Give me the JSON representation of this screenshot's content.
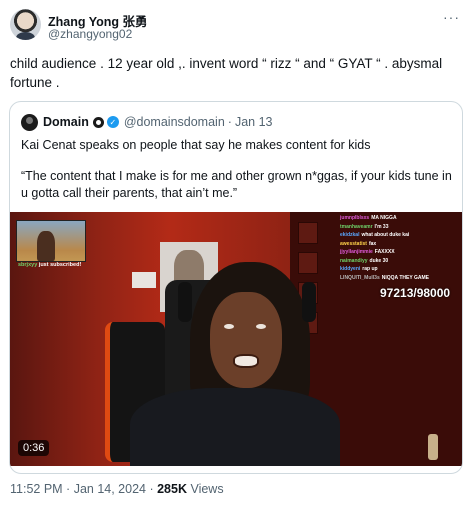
{
  "author": {
    "name": "Zhang Yong 张勇",
    "handle": "@zhangyong02",
    "more_icon": "···"
  },
  "tweet": {
    "text": "child audience . 12 year old  ,. invent word “ rizz “ and “ GYAT “ . abysmal fortune ."
  },
  "quote": {
    "name": "Domain",
    "verified_icon": "✓",
    "handle": "@domainsdomain",
    "dot": "·",
    "date": "Jan 13",
    "line1": "Kai Cenat speaks on people that say he makes content for kids",
    "quote_text": "“The content that I make is for me and other grown n*ggas, if your kids tune in u gotta call their parents, that ain’t me.”"
  },
  "video": {
    "duration": "0:36",
    "counter": "97213/98000",
    "pip_user": "sbrjxyy",
    "pip_msg": " just subscribed!",
    "chat": [
      {
        "user": "jumnplblsxs",
        "msg": "MA NIGGA",
        "color": "#e05adb"
      },
      {
        "user": "tmanhaveamr",
        "msg": "I'm 33",
        "color": "#6fd36a"
      },
      {
        "user": "ekidzkal",
        "msg": "what about duke kai",
        "color": "#5aa8ff"
      },
      {
        "user": "awesstatist",
        "msg": "fax",
        "color": "#ffd34a"
      },
      {
        "user": "jjyyllanjimmie",
        "msg": "FAXXXX",
        "color": "#e05adb"
      },
      {
        "user": "naimandiyy",
        "msg": "duke 30",
        "color": "#6fd36a"
      },
      {
        "user": "kiddyeni",
        "msg": "rap up",
        "color": "#5aa8ff"
      },
      {
        "user": "LINQUITI_Mull3s",
        "msg": "NIQQA THEY GAME",
        "color": "#b8b8b8"
      }
    ]
  },
  "meta": {
    "time": "11:52 PM",
    "sep": " · ",
    "date": "Jan 14, 2024",
    "views_count": "285K",
    "views_label": " Views"
  }
}
